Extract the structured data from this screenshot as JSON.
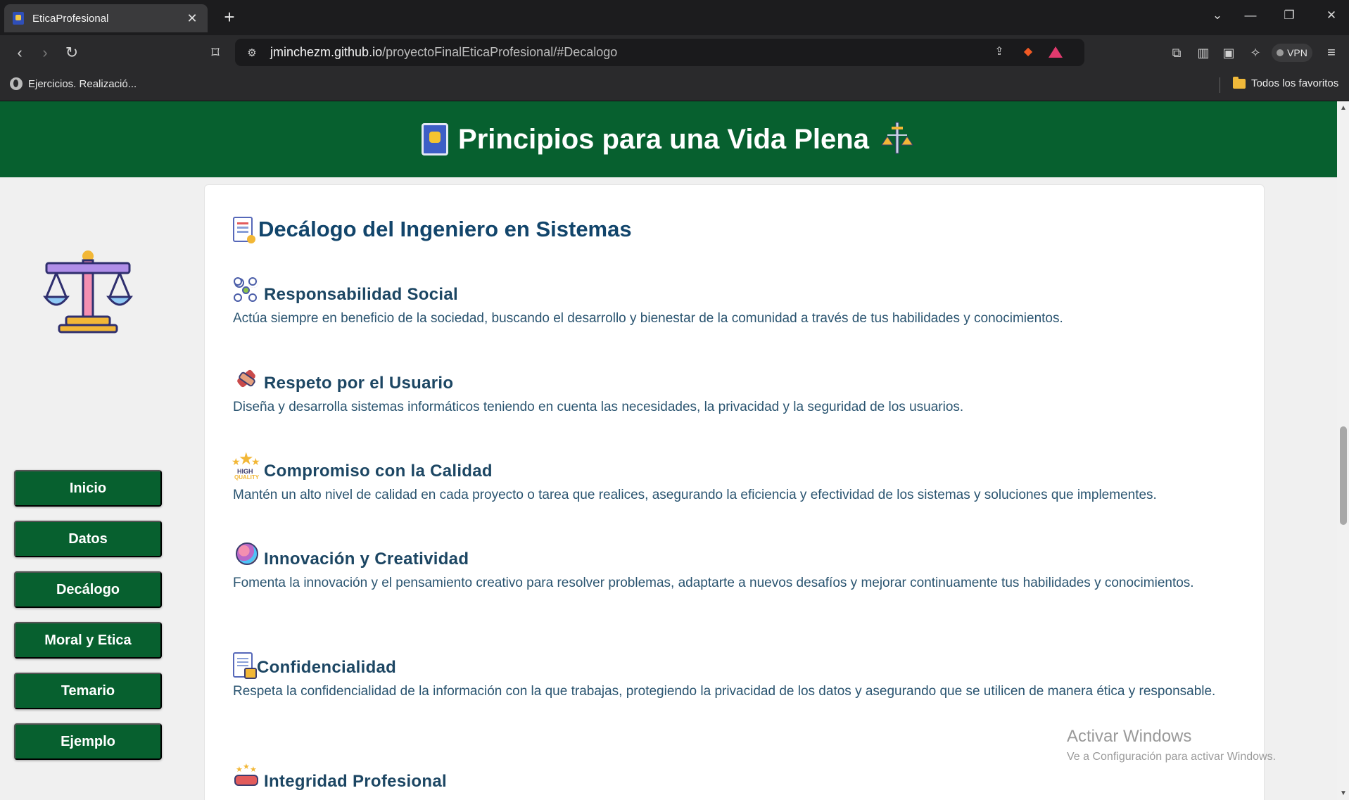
{
  "browser": {
    "tab_title": "EticaProfesional",
    "tab_close": "✕",
    "new_tab": "+",
    "url_host": "jminchezm.github.io",
    "url_path": "/proyectoFinalEticaProfesional/#Decalogo",
    "bookmark_item": "Ejercicios. Realizació...",
    "all_bookmarks": "Todos los favoritos",
    "vpn_label": "VPN",
    "icons": [
      "back-icon",
      "forward-icon",
      "reload-icon",
      "bookmark-icon",
      "site-info-icon",
      "share-icon",
      "brave-shields-icon",
      "brave-rewards-icon",
      "extensions-icon",
      "sidebar-icon",
      "wallet-icon",
      "leo-ai-icon",
      "menu-icon"
    ]
  },
  "header": {
    "title": "Principios para una Vida Plena"
  },
  "sidebar": {
    "nav": [
      {
        "label": "Inicio"
      },
      {
        "label": "Datos"
      },
      {
        "label": "Decálogo"
      },
      {
        "label": "Moral y Etica"
      },
      {
        "label": "Temario"
      },
      {
        "label": "Ejemplo"
      }
    ]
  },
  "main": {
    "title": "Decálogo del Ingeniero en Sistemas",
    "items": [
      {
        "title": "Responsabilidad Social",
        "text": "Actúa siempre en beneficio de la sociedad, buscando el desarrollo y bienestar de la comunidad a través de tus habilidades y conocimientos."
      },
      {
        "title": "Respeto por el Usuario",
        "text": "Diseña y desarrolla sistemas informáticos teniendo en cuenta las necesidades, la privacidad y la seguridad de los usuarios."
      },
      {
        "title": "Compromiso con la Calidad",
        "text": "Mantén un alto nivel de calidad en cada proyecto o tarea que realices, asegurando la eficiencia y efectividad de los sistemas y soluciones que implementes."
      },
      {
        "title": "Innovación y Creatividad",
        "text": "Fomenta la innovación y el pensamiento creativo para resolver problemas, adaptarte a nuevos desafíos y mejorar continuamente tus habilidades y conocimientos."
      },
      {
        "title": "Confidencialidad",
        "text": "Respeta la confidencialidad de la información con la que trabajas, protegiendo la privacidad de los datos y asegurando que se utilicen de manera ética y responsable."
      },
      {
        "title": "Integridad Profesional",
        "text": ""
      }
    ],
    "quality_icon_text_1": "HIGH",
    "quality_icon_text_2": "QUALITY"
  },
  "watermark": {
    "title": "Activar Windows",
    "subtitle": "Ve a Configuración para activar Windows."
  },
  "colors": {
    "brand_green": "#07602f",
    "heading_blue": "#12456b",
    "text_blue": "#2a5470"
  }
}
